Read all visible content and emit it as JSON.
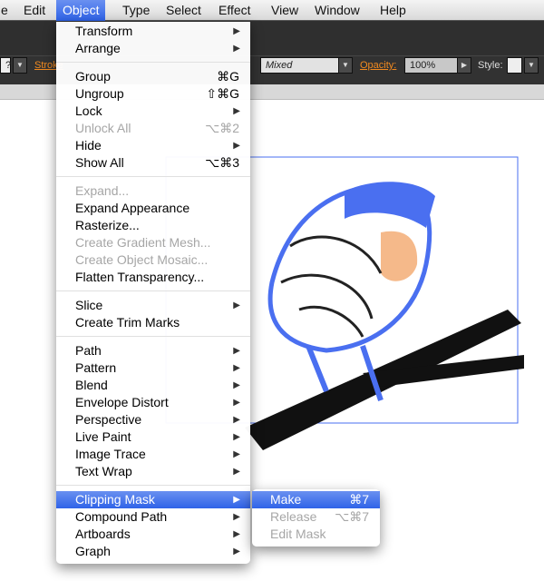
{
  "menubar": [
    "e",
    "Edit",
    "Object",
    "Type",
    "Select",
    "Effect",
    "View",
    "Window",
    "Help"
  ],
  "control": {
    "stroke_label": "Stroke",
    "mixed_value": "Mixed",
    "opacity_label": "Opacity:",
    "opacity_value": "100%",
    "style_label": "Style:",
    "q": "?"
  },
  "object_menu": [
    {
      "label": "Transform",
      "submenu": true
    },
    {
      "label": "Arrange",
      "submenu": true
    },
    {
      "sep": true
    },
    {
      "label": "Group",
      "shortcut": "⌘G"
    },
    {
      "label": "Ungroup",
      "shortcut": "⇧⌘G"
    },
    {
      "label": "Lock",
      "submenu": true
    },
    {
      "label": "Unlock All",
      "shortcut": "⌥⌘2",
      "disabled": true
    },
    {
      "label": "Hide",
      "submenu": true
    },
    {
      "label": "Show All",
      "shortcut": "⌥⌘3"
    },
    {
      "sep": true
    },
    {
      "label": "Expand...",
      "disabled": true
    },
    {
      "label": "Expand Appearance"
    },
    {
      "label": "Rasterize..."
    },
    {
      "label": "Create Gradient Mesh...",
      "disabled": true
    },
    {
      "label": "Create Object Mosaic...",
      "disabled": true
    },
    {
      "label": "Flatten Transparency..."
    },
    {
      "sep": true
    },
    {
      "label": "Slice",
      "submenu": true
    },
    {
      "label": "Create Trim Marks"
    },
    {
      "sep": true
    },
    {
      "label": "Path",
      "submenu": true
    },
    {
      "label": "Pattern",
      "submenu": true
    },
    {
      "label": "Blend",
      "submenu": true
    },
    {
      "label": "Envelope Distort",
      "submenu": true
    },
    {
      "label": "Perspective",
      "submenu": true
    },
    {
      "label": "Live Paint",
      "submenu": true
    },
    {
      "label": "Image Trace",
      "submenu": true
    },
    {
      "label": "Text Wrap",
      "submenu": true
    },
    {
      "sep": true
    },
    {
      "label": "Clipping Mask",
      "submenu": true,
      "highlighted": true
    },
    {
      "label": "Compound Path",
      "submenu": true
    },
    {
      "label": "Artboards",
      "submenu": true
    },
    {
      "label": "Graph",
      "submenu": true
    }
  ],
  "clipping_submenu": [
    {
      "label": "Make",
      "shortcut": "⌘7",
      "highlighted": true
    },
    {
      "label": "Release",
      "shortcut": "⌥⌘7",
      "disabled": true
    },
    {
      "label": "Edit Mask",
      "disabled": true
    }
  ],
  "colors": {
    "selection": "#4a6ff0",
    "highlight": "#3a6cec",
    "accent_orange": "#f28a1f",
    "toolbar": "#2f2f2f"
  },
  "icons": {
    "submenu_arrow": "triangle-right-icon",
    "dropdown": "chevron-down-icon"
  }
}
